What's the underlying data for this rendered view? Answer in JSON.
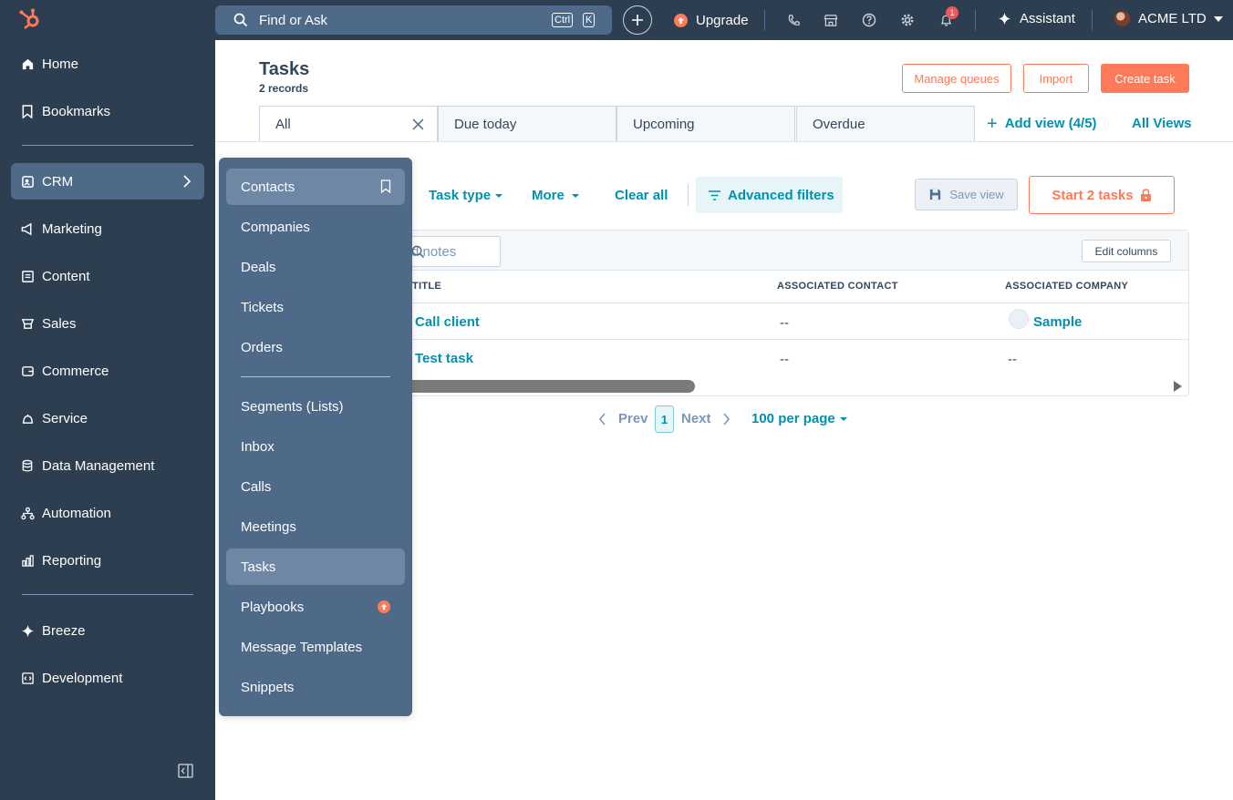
{
  "nav": {
    "items": [
      {
        "label": "Home",
        "icon": "home-icon"
      },
      {
        "label": "Bookmarks",
        "icon": "bookmark-icon"
      },
      {
        "label": "CRM",
        "icon": "crm-icon"
      },
      {
        "label": "Marketing",
        "icon": "megaphone-icon"
      },
      {
        "label": "Content",
        "icon": "content-icon"
      },
      {
        "label": "Sales",
        "icon": "sales-icon"
      },
      {
        "label": "Commerce",
        "icon": "wallet-icon"
      },
      {
        "label": "Service",
        "icon": "service-icon"
      },
      {
        "label": "Data Management",
        "icon": "database-icon"
      },
      {
        "label": "Automation",
        "icon": "workflow-icon"
      },
      {
        "label": "Reporting",
        "icon": "bar-chart-icon"
      },
      {
        "label": "Breeze",
        "icon": "sparkle-icon"
      },
      {
        "label": "Development",
        "icon": "code-icon"
      }
    ],
    "active": "CRM"
  },
  "topbar": {
    "search_placeholder": "Find or Ask",
    "shortcut_ctrl": "Ctrl",
    "shortcut_key": "K",
    "upgrade_label": "Upgrade",
    "notification_count": "1",
    "assistant_label": "Assistant",
    "account_name": "ACME LTD"
  },
  "page": {
    "title": "Tasks",
    "record_count": "2 records",
    "buttons": {
      "manage_queues": "Manage queues",
      "import": "Import",
      "create_task": "Create task"
    },
    "views": [
      "All",
      "Due today",
      "Upcoming",
      "Overdue"
    ],
    "add_view": "Add view (4/5)",
    "all_views": "All Views"
  },
  "filters": {
    "task_type": "Task type",
    "more": "More",
    "clear_all": "Clear all",
    "advanced_filters": "Advanced filters",
    "save_view": "Save view",
    "start_tasks": "Start 2 tasks"
  },
  "table": {
    "search_placeholder": "d notes",
    "edit_columns": "Edit columns",
    "columns": [
      "TITLE",
      "ASSOCIATED CONTACT",
      "ASSOCIATED COMPANY"
    ],
    "rows": [
      {
        "title": "Call client",
        "contact": "--",
        "company": "Sample"
      },
      {
        "title": "Test task",
        "contact": "--",
        "company": "--"
      }
    ]
  },
  "pagination": {
    "prev": "Prev",
    "page": "1",
    "next": "Next",
    "per_page": "100 per page"
  },
  "crm_menu": {
    "items": [
      "Contacts",
      "Companies",
      "Deals",
      "Tickets",
      "Orders",
      "Segments (Lists)",
      "Inbox",
      "Calls",
      "Meetings",
      "Tasks",
      "Playbooks",
      "Message Templates",
      "Snippets"
    ],
    "highlighted": [
      "Contacts",
      "Tasks"
    ]
  },
  "colors": {
    "nav_bg": "#2d3e50",
    "accent_orange": "#ff7a59",
    "link_teal": "#0091ae",
    "flyout_bg": "#4f6a88"
  }
}
